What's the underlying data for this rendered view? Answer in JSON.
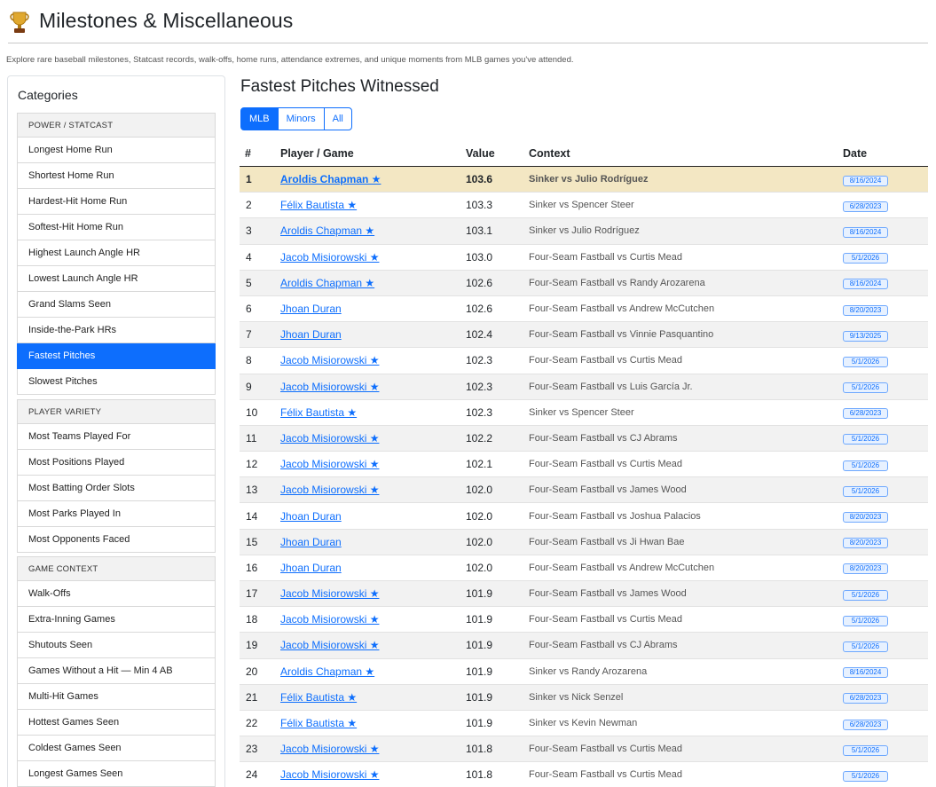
{
  "page": {
    "title": "Milestones & Miscellaneous",
    "subtitle": "Explore rare baseball milestones, Statcast records, walk-offs, home runs, attendance extremes, and unique moments from MLB games you've attended."
  },
  "sidebar": {
    "title": "Categories",
    "groups": [
      {
        "header": "POWER / STATCAST",
        "items": [
          "Longest Home Run",
          "Shortest Home Run",
          "Hardest-Hit Home Run",
          "Softest-Hit Home Run",
          "Highest Launch Angle HR",
          "Lowest Launch Angle HR",
          "Grand Slams Seen",
          "Inside-the-Park HRs",
          "Fastest Pitches",
          "Slowest Pitches"
        ]
      },
      {
        "header": "PLAYER VARIETY",
        "items": [
          "Most Teams Played For",
          "Most Positions Played",
          "Most Batting Order Slots",
          "Most Parks Played In",
          "Most Opponents Faced"
        ]
      },
      {
        "header": "GAME CONTEXT",
        "items": [
          "Walk-Offs",
          "Extra-Inning Games",
          "Shutouts Seen",
          "Games Without a Hit — Min 4 AB",
          "Multi-Hit Games",
          "Hottest Games Seen",
          "Coldest Games Seen",
          "Longest Games Seen"
        ]
      }
    ],
    "active_item": "Fastest Pitches"
  },
  "main": {
    "title": "Fastest Pitches Witnessed",
    "filters": [
      "MLB",
      "Minors",
      "All"
    ],
    "active_filter": "MLB",
    "columns": [
      "#",
      "Player / Game",
      "Value",
      "Context",
      "Date"
    ],
    "rows": [
      {
        "rank": "1",
        "player": "Aroldis Chapman ★",
        "value": "103.6",
        "context": "Sinker vs Julio Rodríguez",
        "date": "8/16/2024"
      },
      {
        "rank": "2",
        "player": "Félix Bautista ★",
        "value": "103.3",
        "context": "Sinker vs Spencer Steer",
        "date": "6/28/2023"
      },
      {
        "rank": "3",
        "player": "Aroldis Chapman ★",
        "value": "103.1",
        "context": "Sinker vs Julio Rodríguez",
        "date": "8/16/2024"
      },
      {
        "rank": "4",
        "player": "Jacob Misiorowski ★",
        "value": "103.0",
        "context": "Four-Seam Fastball vs Curtis Mead",
        "date": "5/1/2026"
      },
      {
        "rank": "5",
        "player": "Aroldis Chapman ★",
        "value": "102.6",
        "context": "Four-Seam Fastball vs Randy Arozarena",
        "date": "8/16/2024"
      },
      {
        "rank": "6",
        "player": "Jhoan Duran",
        "value": "102.6",
        "context": "Four-Seam Fastball vs Andrew McCutchen",
        "date": "8/20/2023"
      },
      {
        "rank": "7",
        "player": "Jhoan Duran",
        "value": "102.4",
        "context": "Four-Seam Fastball vs Vinnie Pasquantino",
        "date": "9/13/2025"
      },
      {
        "rank": "8",
        "player": "Jacob Misiorowski ★",
        "value": "102.3",
        "context": "Four-Seam Fastball vs Curtis Mead",
        "date": "5/1/2026"
      },
      {
        "rank": "9",
        "player": "Jacob Misiorowski ★",
        "value": "102.3",
        "context": "Four-Seam Fastball vs Luis García Jr.",
        "date": "5/1/2026"
      },
      {
        "rank": "10",
        "player": "Félix Bautista ★",
        "value": "102.3",
        "context": "Sinker vs Spencer Steer",
        "date": "6/28/2023"
      },
      {
        "rank": "11",
        "player": "Jacob Misiorowski ★",
        "value": "102.2",
        "context": "Four-Seam Fastball vs CJ Abrams",
        "date": "5/1/2026"
      },
      {
        "rank": "12",
        "player": "Jacob Misiorowski ★",
        "value": "102.1",
        "context": "Four-Seam Fastball vs Curtis Mead",
        "date": "5/1/2026"
      },
      {
        "rank": "13",
        "player": "Jacob Misiorowski ★",
        "value": "102.0",
        "context": "Four-Seam Fastball vs James Wood",
        "date": "5/1/2026"
      },
      {
        "rank": "14",
        "player": "Jhoan Duran",
        "value": "102.0",
        "context": "Four-Seam Fastball vs Joshua Palacios",
        "date": "8/20/2023"
      },
      {
        "rank": "15",
        "player": "Jhoan Duran",
        "value": "102.0",
        "context": "Four-Seam Fastball vs Ji Hwan Bae",
        "date": "8/20/2023"
      },
      {
        "rank": "16",
        "player": "Jhoan Duran",
        "value": "102.0",
        "context": "Four-Seam Fastball vs Andrew McCutchen",
        "date": "8/20/2023"
      },
      {
        "rank": "17",
        "player": "Jacob Misiorowski ★",
        "value": "101.9",
        "context": "Four-Seam Fastball vs James Wood",
        "date": "5/1/2026"
      },
      {
        "rank": "18",
        "player": "Jacob Misiorowski ★",
        "value": "101.9",
        "context": "Four-Seam Fastball vs Curtis Mead",
        "date": "5/1/2026"
      },
      {
        "rank": "19",
        "player": "Jacob Misiorowski ★",
        "value": "101.9",
        "context": "Four-Seam Fastball vs CJ Abrams",
        "date": "5/1/2026"
      },
      {
        "rank": "20",
        "player": "Aroldis Chapman ★",
        "value": "101.9",
        "context": "Sinker vs Randy Arozarena",
        "date": "8/16/2024"
      },
      {
        "rank": "21",
        "player": "Félix Bautista ★",
        "value": "101.9",
        "context": "Sinker vs Nick Senzel",
        "date": "6/28/2023"
      },
      {
        "rank": "22",
        "player": "Félix Bautista ★",
        "value": "101.9",
        "context": "Sinker vs Kevin Newman",
        "date": "6/28/2023"
      },
      {
        "rank": "23",
        "player": "Jacob Misiorowski ★",
        "value": "101.8",
        "context": "Four-Seam Fastball vs Curtis Mead",
        "date": "5/1/2026"
      },
      {
        "rank": "24",
        "player": "Jacob Misiorowski ★",
        "value": "101.8",
        "context": "Four-Seam Fastball vs Curtis Mead",
        "date": "5/1/2026"
      }
    ]
  },
  "colors": {
    "accent": "#0d6efd",
    "highlight_row": "#f3e7c3",
    "badge_bg": "#e7f1ff"
  },
  "icons": {
    "header": "trophy-icon"
  }
}
